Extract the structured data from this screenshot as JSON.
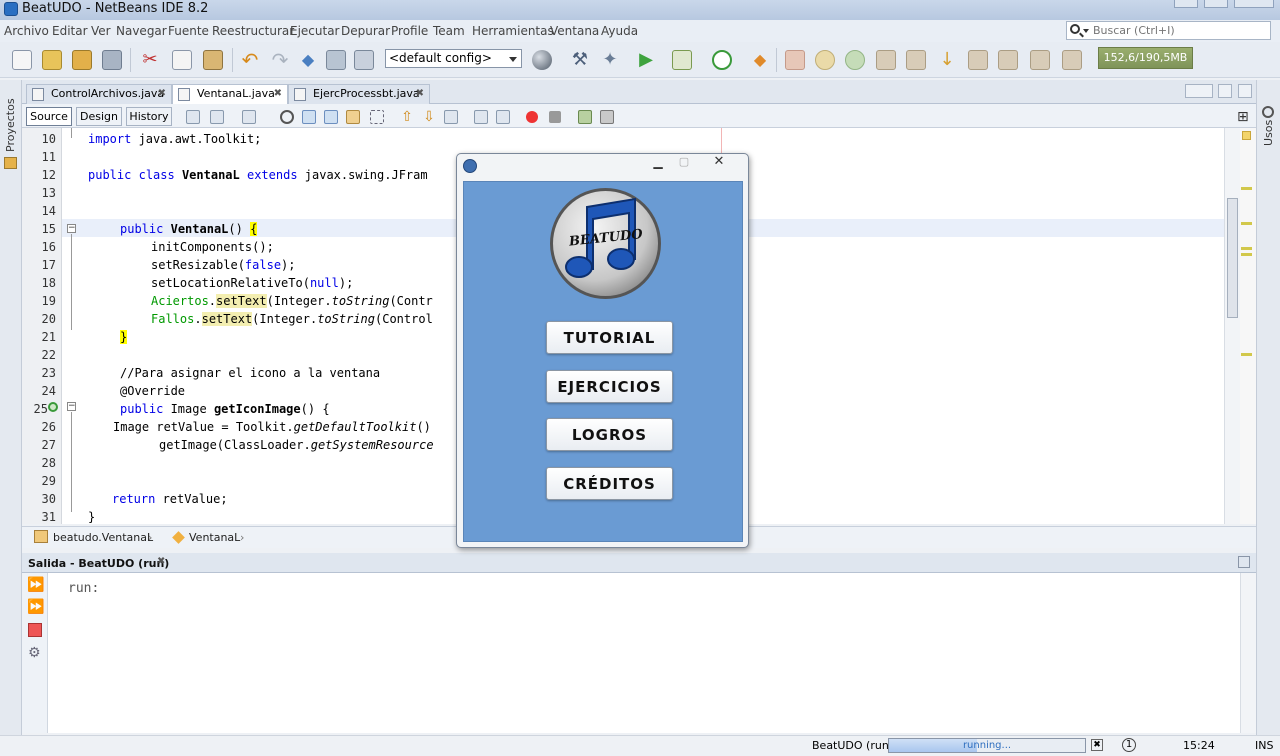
{
  "window": {
    "title": "BeatUDO - NetBeans IDE 8.2"
  },
  "menu": {
    "items": [
      "Archivo",
      "Editar",
      "Ver",
      "Navegar",
      "Fuente",
      "Reestructurar",
      "Ejecutar",
      "Depurar",
      "Profile",
      "Team",
      "Herramientas",
      "Ventana",
      "Ayuda"
    ]
  },
  "search": {
    "placeholder": "Buscar (Ctrl+I)"
  },
  "toolbar": {
    "config": "<default config>",
    "memory": "152,6/190,5MB"
  },
  "side": {
    "left_label": "Proyectos",
    "right_label": "Usos"
  },
  "tabs": [
    {
      "label": "ControlArchivos.java",
      "active": false
    },
    {
      "label": "VentanaL.java",
      "active": true
    },
    {
      "label": "EjercProcessbt.java",
      "active": false
    }
  ],
  "editor": {
    "source": "Source",
    "design": "Design",
    "history": "History"
  },
  "code": {
    "line_numbers": [
      "10",
      "11",
      "12",
      "13",
      "14",
      "15",
      "16",
      "17",
      "18",
      "19",
      "20",
      "21",
      "22",
      "23",
      "24",
      "25",
      "26",
      "27",
      "28",
      "29",
      "30",
      "31"
    ],
    "l10": "import",
    "l10b": " java.awt.Toolkit;",
    "l12a": "public",
    "l12b": "class",
    "l12c": "VentanaL",
    "l12d": "extends",
    "l12e": " javax.swing.JFram",
    "l15a": "public",
    "l15b": "VentanaL",
    "l15c": "() ",
    "l15d": "{",
    "l16": "initComponents();",
    "l17a": "setResizable(",
    "l17b": "false",
    "l17c": ");",
    "l18a": "setLocationRelativeTo(",
    "l18b": "null",
    "l18c": ");",
    "l19a": "Aciertos",
    "l19b": ".",
    "l19c": "setText",
    "l19d": "(Integer.",
    "l19e": "toString",
    "l19f": "(Contr",
    "l20a": "Fallos",
    "l20b": ".",
    "l20c": "setText",
    "l20d": "(Integer.",
    "l20e": "toString",
    "l20f": "(Control",
    "l21": "}",
    "l23": "//Para asignar el icono a la ventana",
    "l24": "@Override",
    "l25a": "public",
    "l25b": " Image ",
    "l25c": "getIconImage",
    "l25d": "() {",
    "l26a": "Image retValue = Toolkit.",
    "l26b": "getDefaultToolkit",
    "l26c": "()",
    "l27a": "getImage(ClassLoader.",
    "l27b": "getSystemResource",
    "l30a": "return",
    "l30b": " retValue;",
    "l31": "}"
  },
  "breadcrumb": {
    "class_path": "beatudo.VentanaL",
    "member": "VentanaL"
  },
  "output": {
    "title": "Salida - BeatUDO (run)",
    "text": "run:"
  },
  "status": {
    "project": "BeatUDO (run)",
    "progress_label": "running...",
    "progress_fraction": 0.45,
    "time": "15:24",
    "mode": "INS",
    "notif_count": "1"
  },
  "app": {
    "logo_text": "BEATUDO",
    "buttons": [
      "TUTORIAL",
      "EJERCICIOS",
      "LOGROS",
      "CRÉDITOS"
    ]
  },
  "colors": {
    "app_bg": "#6a9bd3",
    "keyword": "#0000e6",
    "field": "#009900",
    "comment": "#969696"
  }
}
